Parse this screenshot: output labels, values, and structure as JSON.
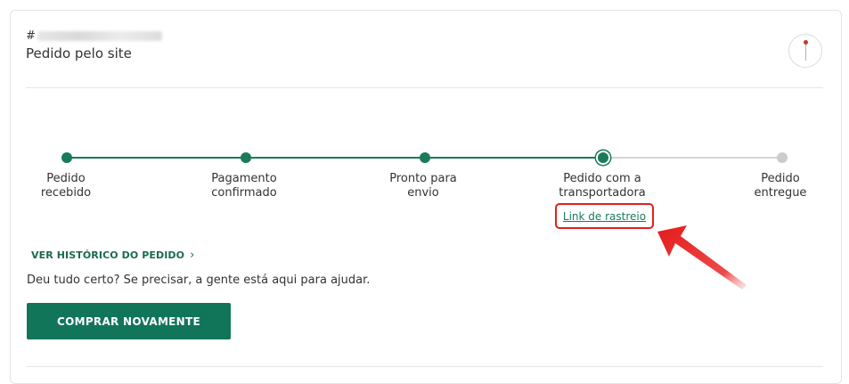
{
  "order": {
    "id_prefix": "#",
    "origin": "Pedido pelo site"
  },
  "steps": [
    {
      "label": "Pedido\nrecebido",
      "status": "done"
    },
    {
      "label": "Pagamento\nconfirmado",
      "status": "done"
    },
    {
      "label": "Pronto para\nenvio",
      "status": "done"
    },
    {
      "label": "Pedido com a\ntransportadora",
      "status": "current"
    },
    {
      "label": "Pedido\nentregue",
      "status": "pending"
    }
  ],
  "tracking": {
    "link_label": "Link de rastreio"
  },
  "history": {
    "link_label": "VER HISTÓRICO DO PEDIDO",
    "chevron": "›"
  },
  "help": {
    "text": "Deu tudo certo? Se precisar, a gente está aqui para ajudar."
  },
  "actions": {
    "buy_again_label": "COMPRAR NOVAMENTE"
  },
  "colors": {
    "accent": "#1a7a5c",
    "pending": "#cccccc",
    "highlight": "#e02020",
    "button": "#11755a"
  },
  "icons": {
    "top_right": "compass-icon",
    "annotation": "red-arrow-icon"
  }
}
